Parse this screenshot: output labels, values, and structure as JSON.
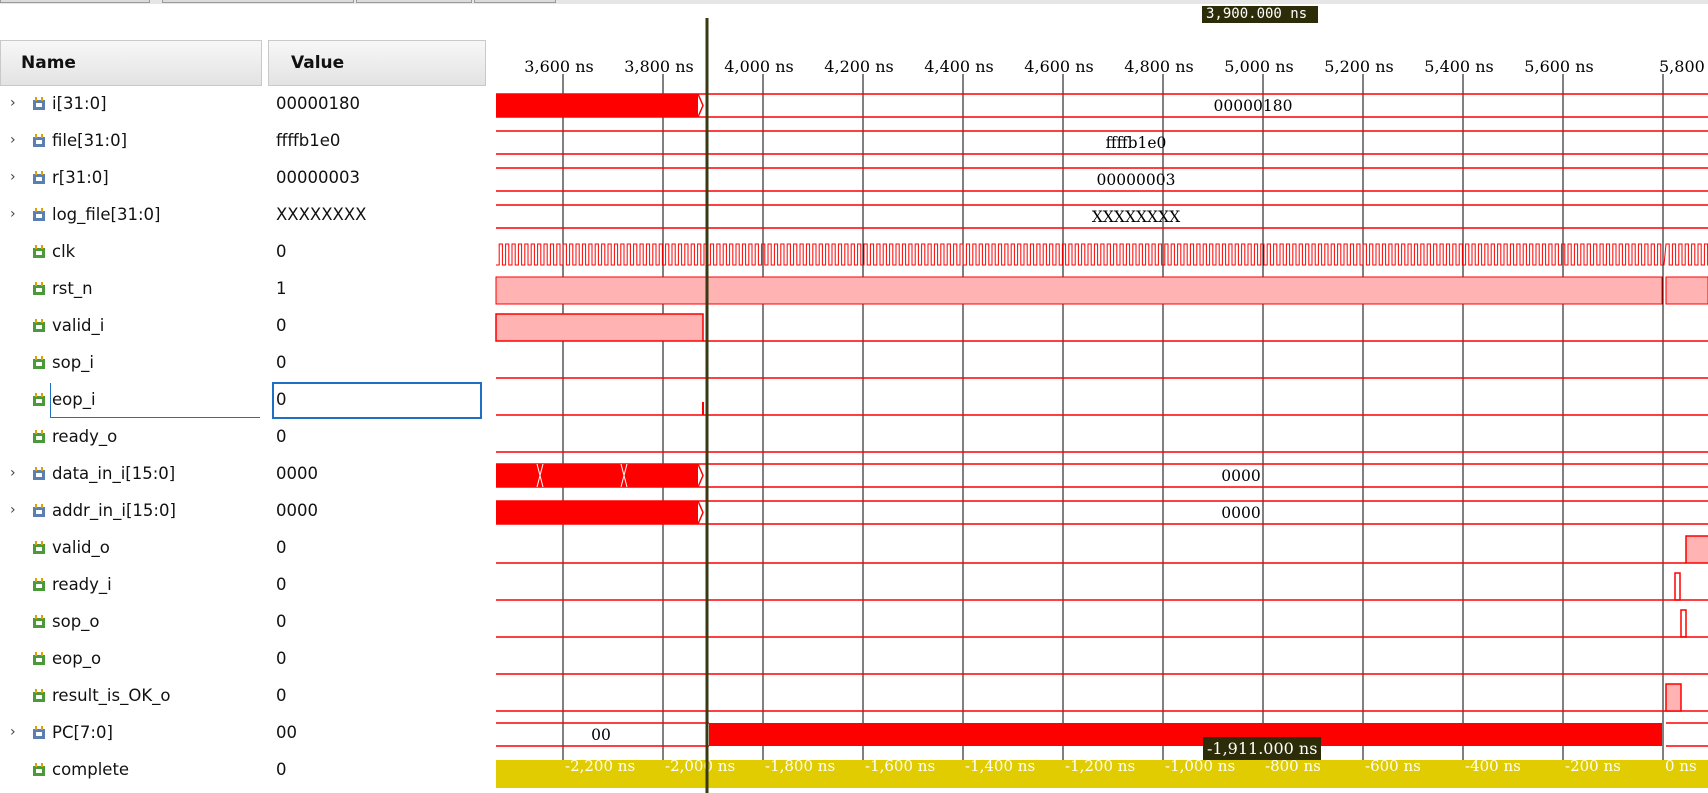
{
  "columns": {
    "name": "Name",
    "value": "Value"
  },
  "cursor_time": "3,900.000 ns",
  "delta_time": "-1,911.000 ns",
  "timeline": {
    "labels": [
      "3,600 ns",
      "3,800 ns",
      "4,000 ns",
      "4,200 ns",
      "4,400 ns",
      "4,600 ns",
      "4,800 ns",
      "5,000 ns",
      "5,200 ns",
      "5,400 ns",
      "5,600 ns",
      "5,800"
    ],
    "relative_labels": [
      "-2,200 ns",
      "-2,000 ns",
      "-1,800 ns",
      "-1,600 ns",
      "-1,400 ns",
      "-1,200 ns",
      "-1,000 ns",
      "-800 ns",
      "-600 ns",
      "-400 ns",
      "-200 ns",
      "0 ns"
    ]
  },
  "signals": [
    {
      "name": "i[31:0]",
      "value": "00000180",
      "type": "bus",
      "expandable": true,
      "wave_text": "00000180"
    },
    {
      "name": "file[31:0]",
      "value": "ffffb1e0",
      "type": "bus",
      "expandable": true,
      "wave_text": "ffffb1e0"
    },
    {
      "name": "r[31:0]",
      "value": "00000003",
      "type": "bus",
      "expandable": true,
      "wave_text": "00000003"
    },
    {
      "name": "log_file[31:0]",
      "value": "XXXXXXXX",
      "type": "bus",
      "expandable": true,
      "wave_text": "XXXXXXXX"
    },
    {
      "name": "clk",
      "value": "0",
      "type": "bit",
      "expandable": false
    },
    {
      "name": "rst_n",
      "value": "1",
      "type": "bit",
      "expandable": false
    },
    {
      "name": "valid_i",
      "value": "0",
      "type": "bit",
      "expandable": false
    },
    {
      "name": "sop_i",
      "value": "0",
      "type": "bit",
      "expandable": false
    },
    {
      "name": "eop_i",
      "value": "0",
      "type": "bit",
      "expandable": false,
      "selected": true
    },
    {
      "name": "ready_o",
      "value": "0",
      "type": "bit",
      "expandable": false
    },
    {
      "name": "data_in_i[15:0]",
      "value": "0000",
      "type": "bus",
      "expandable": true,
      "wave_text": "0000"
    },
    {
      "name": "addr_in_i[15:0]",
      "value": "0000",
      "type": "bus",
      "expandable": true,
      "wave_text": "0000"
    },
    {
      "name": "valid_o",
      "value": "0",
      "type": "bit",
      "expandable": false
    },
    {
      "name": "ready_i",
      "value": "0",
      "type": "bit",
      "expandable": false
    },
    {
      "name": "sop_o",
      "value": "0",
      "type": "bit",
      "expandable": false
    },
    {
      "name": "eop_o",
      "value": "0",
      "type": "bit",
      "expandable": false
    },
    {
      "name": "result_is_OK_o",
      "value": "0",
      "type": "bit",
      "expandable": false
    },
    {
      "name": "PC[7:0]",
      "value": "00",
      "type": "bus",
      "expandable": true,
      "wave_text": "00"
    },
    {
      "name": "complete",
      "value": "0",
      "type": "bit",
      "expandable": false
    }
  ],
  "colors": {
    "wave": "#ff0000",
    "wave_fill": "#ffb3b3",
    "cursor": "#3a3a12",
    "relative_bar": "#e0cc00",
    "icon_bus": "#5a7fb0",
    "icon_bit": "#4a9a3a"
  }
}
